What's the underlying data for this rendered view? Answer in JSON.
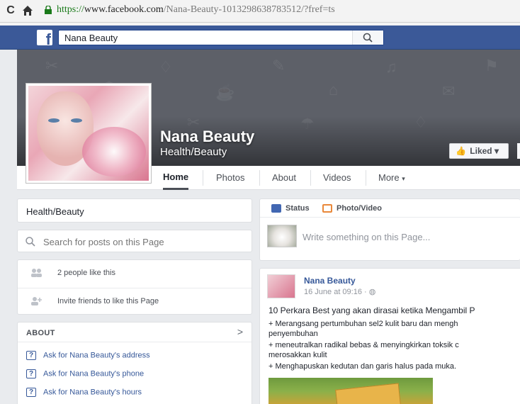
{
  "browser": {
    "url_secure": "https://",
    "url_domain": "www.facebook.com",
    "url_path": "/Nana-Beauty-1013298638783512/?fref=ts"
  },
  "fb": {
    "search_value": "Nana Beauty",
    "logo": "f"
  },
  "page": {
    "name": "Nana Beauty",
    "category": "Health/Beauty",
    "liked_label": "Liked"
  },
  "tabs": [
    "Home",
    "Photos",
    "About",
    "Videos",
    "More"
  ],
  "sidebar": {
    "category": "Health/Beauty",
    "search_placeholder": "Search for posts on this Page",
    "likes_text": "2 people like this",
    "invite_text": "Invite friends to like this Page",
    "about_title": "ABOUT",
    "questions": [
      "Ask for Nana Beauty's address",
      "Ask for Nana Beauty's phone",
      "Ask for Nana Beauty's hours"
    ]
  },
  "composer": {
    "status_label": "Status",
    "photo_label": "Photo/Video",
    "placeholder": "Write something on this Page..."
  },
  "post": {
    "author": "Nana Beauty",
    "date": "16 June at 09:16 · ",
    "title": "10 Perkara Best yang akan dirasai ketika Mengambil P",
    "lines": [
      "+ Merangsang pertumbuhan sel2 kulit baru dan mengh",
      "penyembuhan",
      "+ meneutralkan radikal bebas & menyingkirkan toksik c",
      "merosakkan kulit",
      "+ Menghapuskan kedutan dan garis halus pada muka."
    ]
  },
  "colors": {
    "fb_blue": "#3b5998",
    "link_blue": "#365899",
    "bg": "#e9ebee"
  }
}
